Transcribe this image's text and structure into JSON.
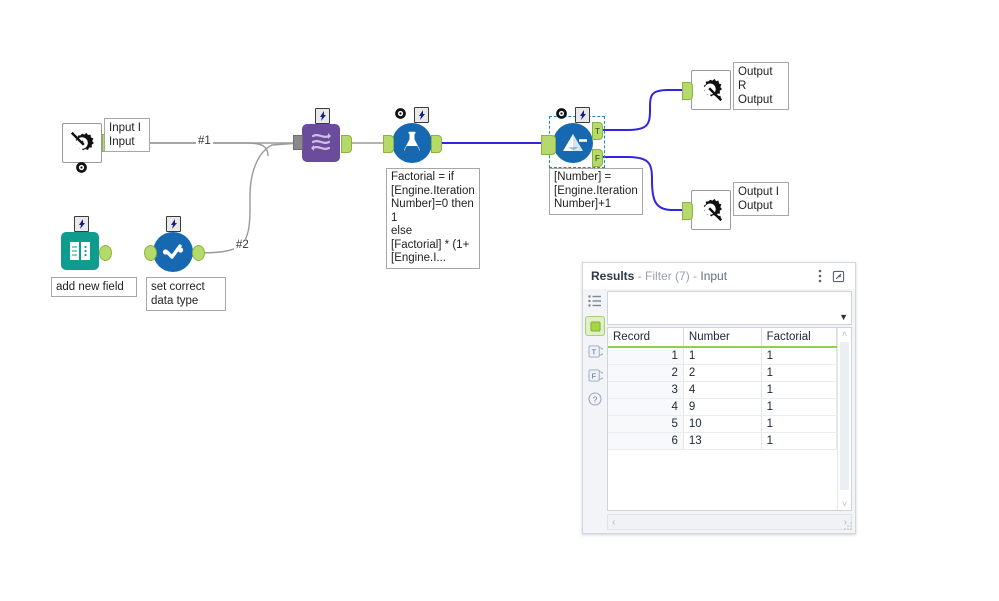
{
  "canvas": {
    "tools": [
      {
        "id": "macro-input",
        "name": "Macro Input",
        "icon": "gear-arrow-in-icon",
        "annotation": "Input\nI Input",
        "badge": "config-gear"
      },
      {
        "id": "text-input",
        "name": "Text Input",
        "icon": "book-icon",
        "annotation": "add new field",
        "badge": "lightning"
      },
      {
        "id": "select",
        "name": "Select",
        "icon": "check-circle-icon",
        "annotation": "set correct data type",
        "badge": "lightning"
      },
      {
        "id": "iterative-macro",
        "name": "Iterative Macro",
        "icon": "loop-arrows-icon",
        "annotation": "",
        "badge": "lightning"
      },
      {
        "id": "formula",
        "name": "Formula",
        "icon": "flask-icon",
        "annotation": "Factorial = if\n[Engine.Iteration\nNumber]=0 then\n1\nelse\n[Factorial] * (1+\n[Engine.I...",
        "badge": "lightning-gear"
      },
      {
        "id": "filter",
        "name": "Filter",
        "icon": "funnel-icon",
        "annotation": "[Number] =\n[Engine.Iteration\nNumber]+1",
        "badge": "lightning-gear"
      },
      {
        "id": "macro-output-r",
        "name": "Macro Output R",
        "icon": "gear-arrow-out-icon",
        "annotation": "Output\nR Output",
        "badge": ""
      },
      {
        "id": "macro-output-i",
        "name": "Macro Output I",
        "icon": "gear-arrow-out-icon",
        "annotation": "Output\nI Output",
        "badge": ""
      }
    ],
    "connection_labels": {
      "one": "#1",
      "two": "#2"
    },
    "filter_outputs": {
      "true": "T",
      "false": "F"
    },
    "colors": {
      "anchor": "#b5d96b",
      "macro_purple": "#6b4b9c",
      "select_blue": "#1669b0",
      "text_input_teal": "#0f9b8e",
      "wire_selected": "#3224e0",
      "wire_default": "#9a9a9a",
      "grid_accent": "#8dd14f"
    }
  },
  "results": {
    "title": "Results",
    "subtitle_tool": "- Filter (7) -",
    "subtitle_anchor": "Input",
    "header_icons": {
      "menu": "kebab-menu-icon",
      "popout": "pop-out-icon"
    },
    "rail_icons": [
      "list-icon",
      "input-anchor-icon",
      "t-anchor-icon",
      "f-anchor-icon",
      "help-icon"
    ],
    "columns": [
      "Record",
      "Number",
      "Factorial"
    ],
    "rows": [
      {
        "record": "1",
        "number": "1",
        "factorial": "1"
      },
      {
        "record": "2",
        "number": "2",
        "factorial": "1"
      },
      {
        "record": "3",
        "number": "4",
        "factorial": "1"
      },
      {
        "record": "4",
        "number": "9",
        "factorial": "1"
      },
      {
        "record": "5",
        "number": "10",
        "factorial": "1"
      },
      {
        "record": "6",
        "number": "13",
        "factorial": "1"
      }
    ],
    "scroll": {
      "left_arrow": "‹",
      "right_arrow": "›",
      "up_arrow": "˄",
      "down_arrow": "˅"
    }
  }
}
